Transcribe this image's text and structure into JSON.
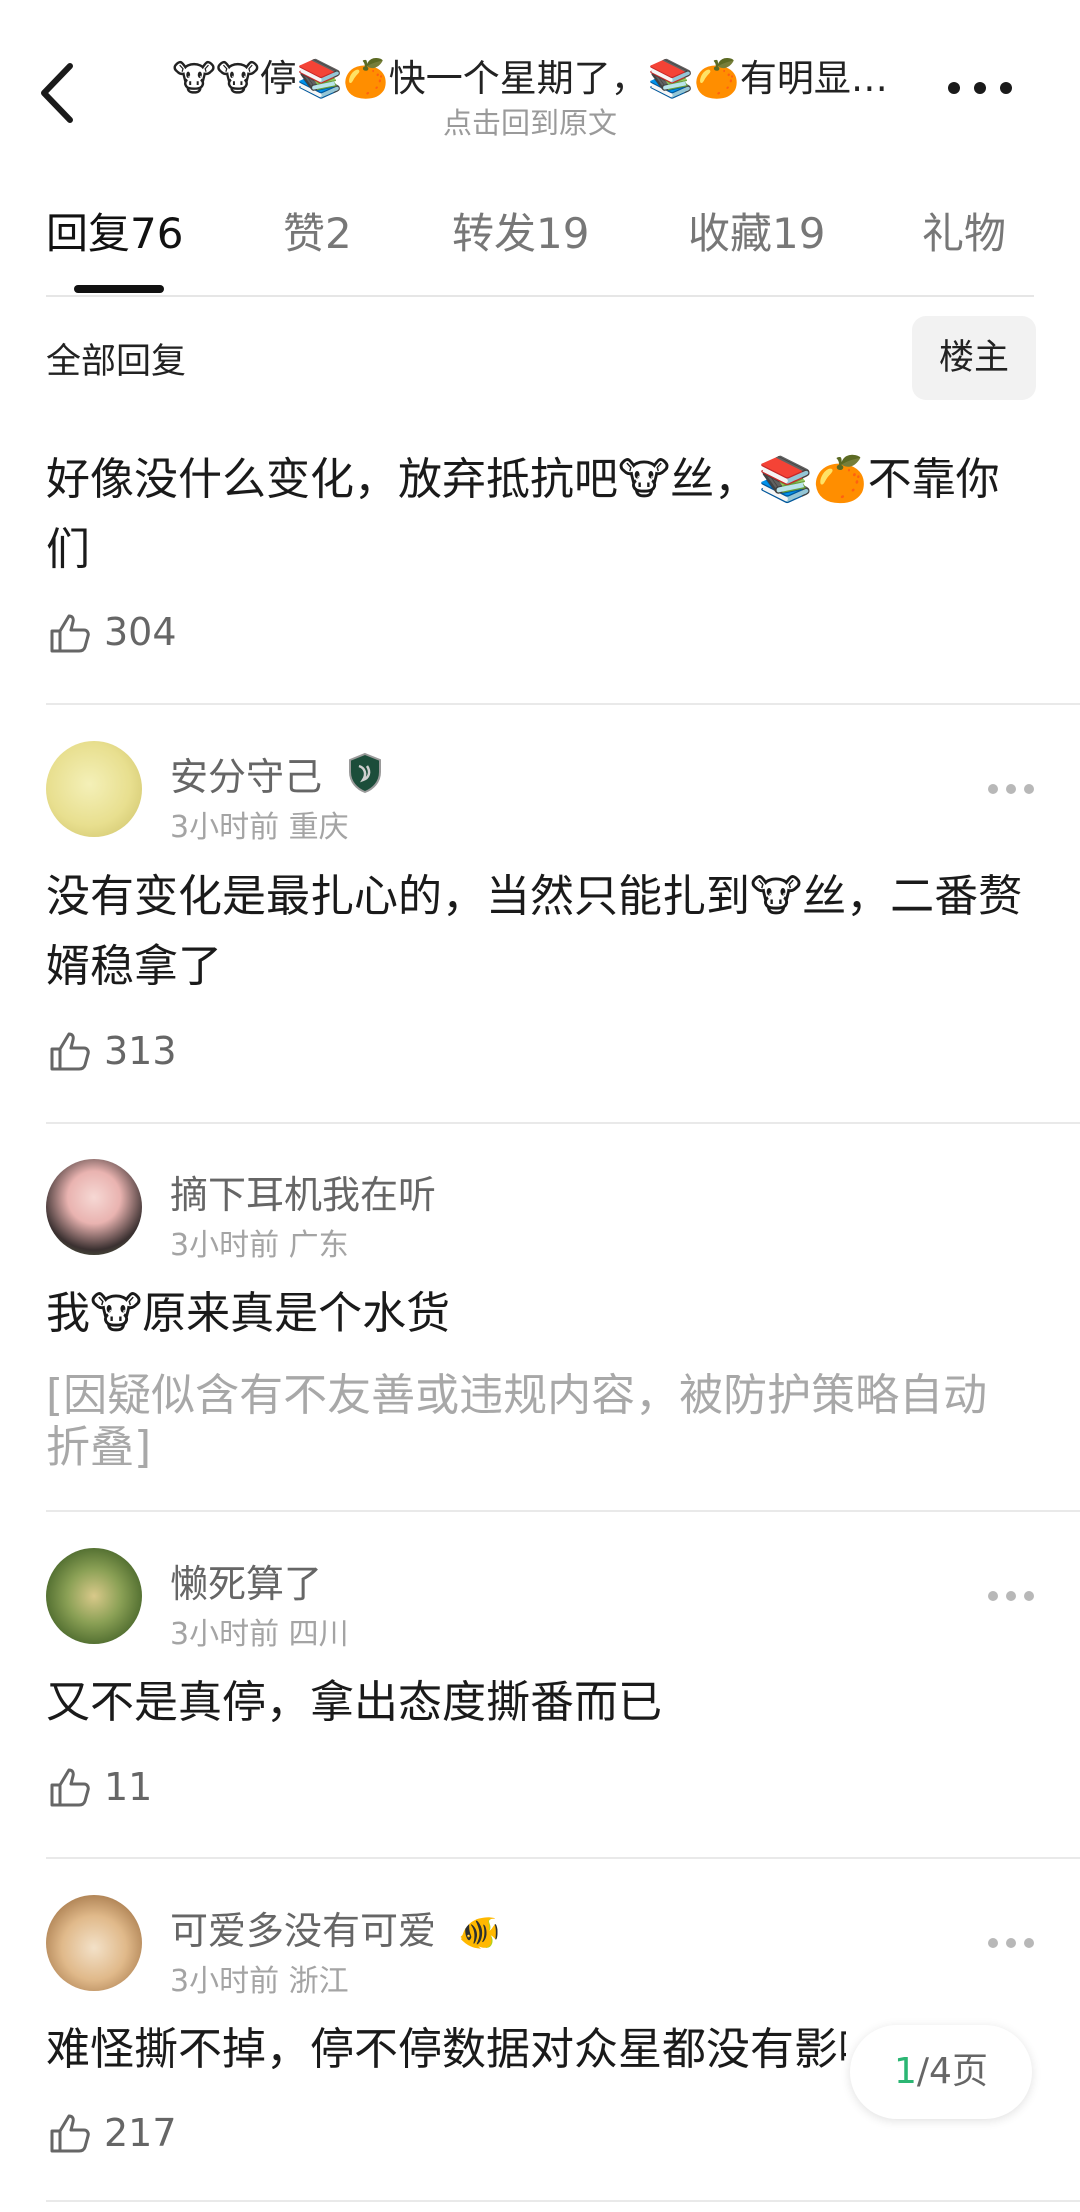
{
  "header": {
    "title": "🐮🐮停📚🍊快一个星期了，📚🍊有明显…",
    "subtitle": "点击回到原文"
  },
  "tabs": [
    {
      "label": "回复",
      "count": "76"
    },
    {
      "label": "赞",
      "count": "2"
    },
    {
      "label": "转发",
      "count": "19"
    },
    {
      "label": "收藏",
      "count": "19"
    },
    {
      "label": "礼物",
      "count": ""
    }
  ],
  "filter": {
    "label": "全部回复",
    "owner_button": "楼主"
  },
  "comments": [
    {
      "content": "好像没什么变化，放弃抵抗吧🐮丝，📚🍊不靠你们",
      "likes": "304"
    },
    {
      "username": "安分守己",
      "meta": "3小时前  重庆",
      "content": "没有变化是最扎心的，当然只能扎到🐮丝，二番赘婿稳拿了",
      "likes": "313"
    },
    {
      "username": "摘下耳机我在听",
      "meta": "3小时前  广东",
      "content": "我🐮原来真是个水货",
      "folded": "[因疑似含有不友善或违规内容，被防护策略自动折叠]"
    },
    {
      "username": "懒死算了",
      "meta": "3小时前  四川",
      "content": "又不是真停，拿出态度撕番而已",
      "likes": "11"
    },
    {
      "username": "可爱多没有可爱",
      "badge": "🐠",
      "meta": "3小时前  浙江",
      "content": "难怪撕不掉，停不停数据对众星都没有影响",
      "likes": "217"
    }
  ],
  "pager": {
    "current": "1",
    "rest": "/4页"
  },
  "icons": {
    "back": "chevron-left-icon",
    "more": "more-horizontal-icon",
    "like": "thumbs-up-icon",
    "badge": "shield-badge-icon"
  }
}
